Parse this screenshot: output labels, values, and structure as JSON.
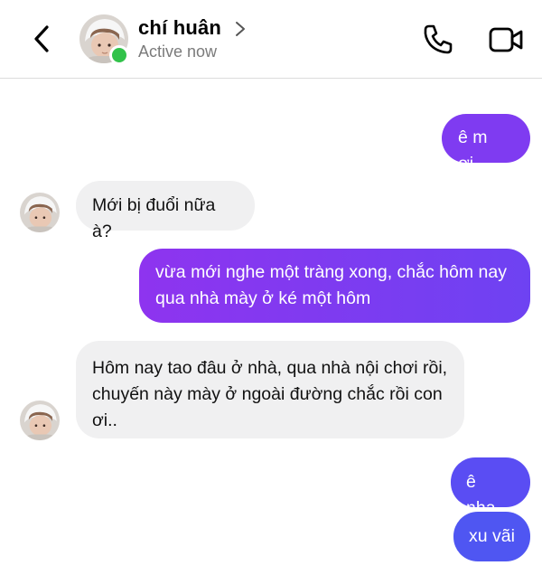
{
  "header": {
    "contact_name": "chí huân",
    "status": "Active now",
    "icons": [
      "back-arrow-icon",
      "chevron-right-icon",
      "phone-icon",
      "video-camera-icon"
    ],
    "online_color": "#31c24a"
  },
  "colors": {
    "outgoing_gradient_start": "#5b4bf5",
    "outgoing_gradient_end": "#8a36f0",
    "incoming_bg": "#f0f0f1"
  },
  "messages": [
    {
      "from": "me",
      "text": "ê m ơi.."
    },
    {
      "from": "them",
      "text": "Mới bị đuổi nữa à?"
    },
    {
      "from": "me",
      "text": "vừa mới nghe một tràng xong, chắc hôm nay qua nhà mày ở ké một hôm"
    },
    {
      "from": "them",
      "text": "Hôm nay tao đâu ở nhà, qua nhà nội chơi rồi, chuyến này mày ở ngoài đường chắc rồi con ơi.."
    },
    {
      "from": "me",
      "text": "ê nha."
    },
    {
      "from": "me",
      "text": "xu vãi"
    }
  ]
}
